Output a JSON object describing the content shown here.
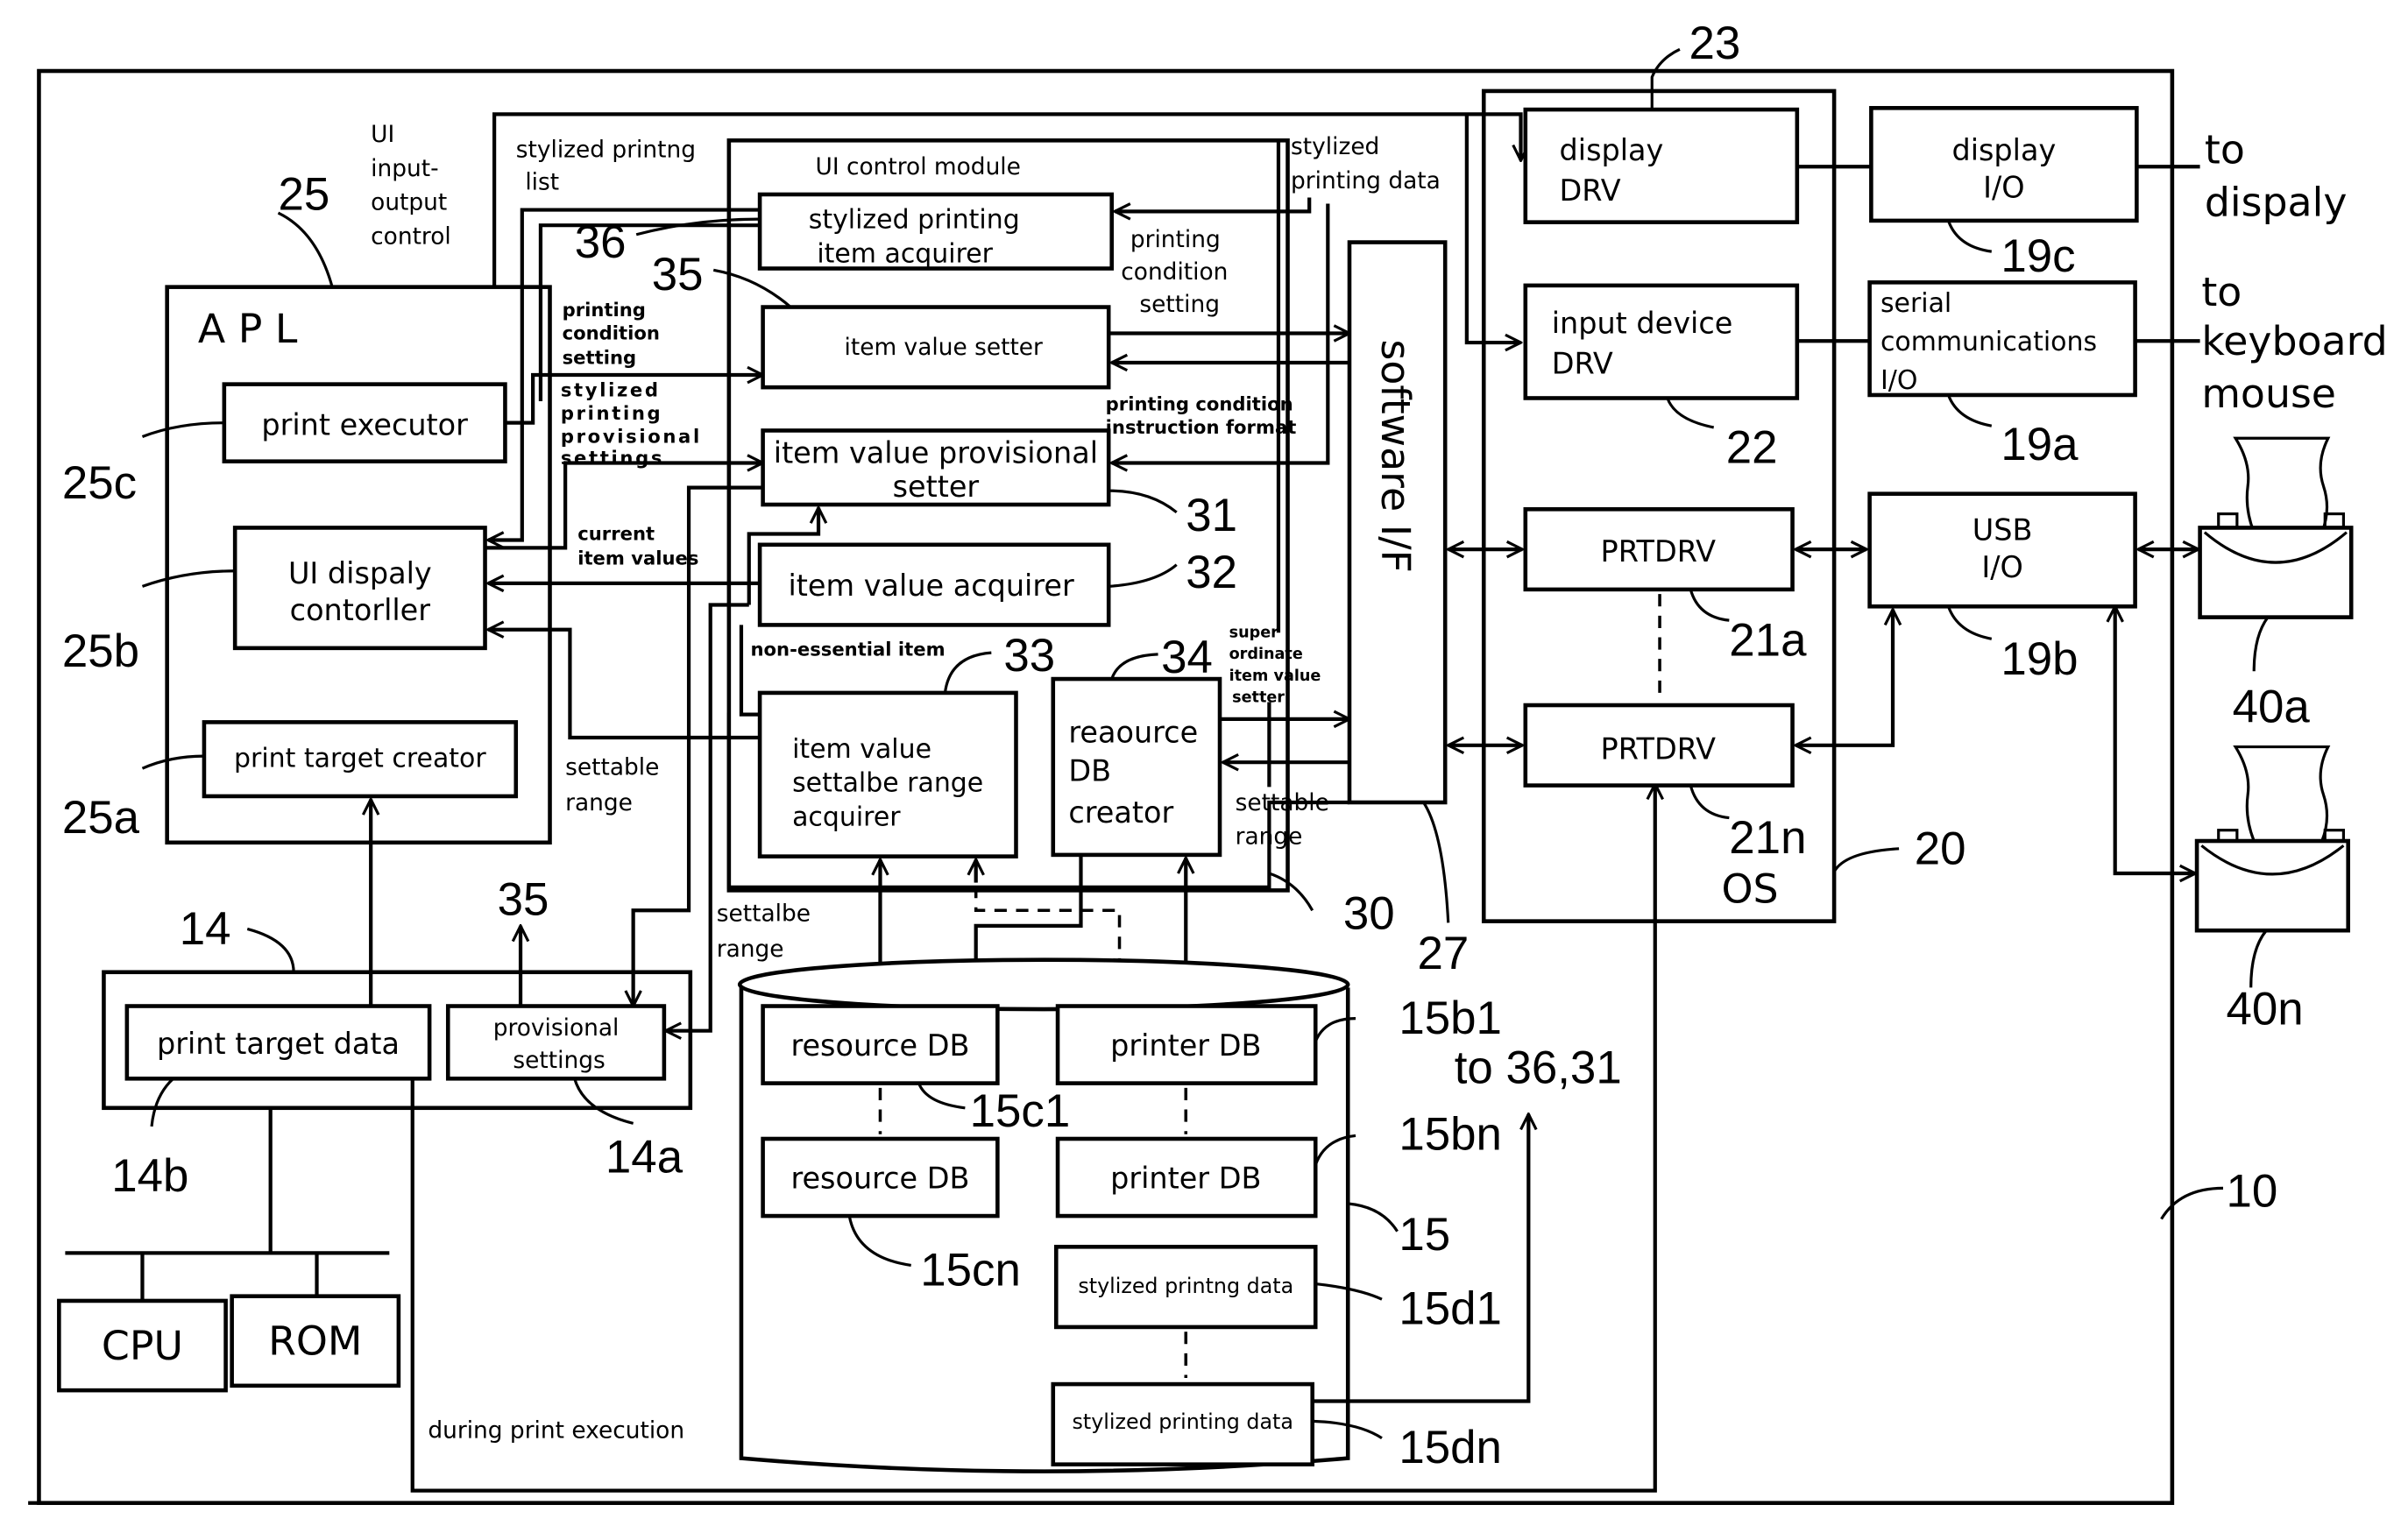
{
  "figure": {
    "outer_ref": "10",
    "apl": {
      "title": "A P L",
      "ref": "25",
      "control_label": [
        "UI",
        "input-",
        "output",
        "control"
      ],
      "print_executor": {
        "label": "print executor",
        "ref": "25c"
      },
      "ui_display_controller": {
        "line1": "UI dispaly",
        "line2": "contorller",
        "ref": "25b"
      },
      "print_target_creator": {
        "label": "print target creator",
        "ref": "25a"
      }
    },
    "memory": {
      "ref": "14",
      "print_target_data": {
        "label": "print target data",
        "ref": "14b"
      },
      "provisional_settings": {
        "line1": "provisional",
        "line2": "settings",
        "ref": "14a"
      },
      "to_ref": "35"
    },
    "hardware": {
      "cpu": "CPU",
      "rom": "ROM"
    },
    "ui_control_module": {
      "title": "UI control module",
      "ref": "30",
      "stylized_printing_item_acquirer": {
        "line1": "stylized printing",
        "line2": "item acquirer",
        "ref": "36"
      },
      "item_value_setter": {
        "label": "item value setter",
        "ref": "35"
      },
      "item_value_provisional_setter": {
        "line1": "item value provisional",
        "line2": "setter",
        "ref": "31"
      },
      "item_value_acquirer": {
        "label": "item value acquirer",
        "ref": "32"
      },
      "item_value_settable_range_acquirer": {
        "line1": "item value",
        "line2": "settalbe range",
        "line3": "acquirer",
        "ref": "33"
      },
      "resource_db_creator": {
        "line1": "reaource",
        "line2": "DB",
        "line3": "creator",
        "ref": "34"
      }
    },
    "flow_labels": {
      "stylized_printing_list": [
        "stylized printng",
        "list"
      ],
      "stylized_printing_data": [
        "stylized",
        "printing data"
      ],
      "printing_condition_setting_right": [
        "printing",
        "condition",
        "setting"
      ],
      "printing_condition_setting_left": [
        "printing",
        "condition",
        "setting"
      ],
      "stylized_printing_provisional_settings": [
        "stylized",
        "printing",
        "provisional",
        "settings"
      ],
      "current_item_values": [
        "current",
        "item values"
      ],
      "printing_condition_instruction_format": [
        "printing condition",
        "instruction format"
      ],
      "non_essential_item": "non-essential item",
      "super_ordinate_item_value_setter": [
        "super",
        "ordinate",
        "item value",
        "setter"
      ],
      "settable_range_left": [
        "settable",
        "range"
      ],
      "settable_range_right": [
        "settable",
        "range"
      ],
      "settable_range_bottom": [
        "settalbe",
        "range"
      ],
      "during_print_execution": "during print execution",
      "to_36_31": "to 36,31"
    },
    "software_if": {
      "label": "software I/F",
      "ref": "27"
    },
    "os": {
      "label": "OS",
      "ref": "20",
      "display_drv": {
        "line1": "display",
        "line2": "DRV",
        "ref": "23"
      },
      "input_device_drv": {
        "line1": "input device",
        "line2": "DRV",
        "ref": "22"
      },
      "prtdrv_a": {
        "label": "PRTDRV",
        "ref": "21a"
      },
      "prtdrv_n": {
        "label": "PRTDRV",
        "ref": "21n"
      }
    },
    "io": {
      "display_io": {
        "line1": "display",
        "line2": "I/O",
        "ref": "19c"
      },
      "serial_io": {
        "line1": "serial",
        "line2": "communications",
        "line3": "I/O",
        "ref": "19a"
      },
      "usb_io": {
        "line1": "USB",
        "line2": "I/O",
        "ref": "19b"
      }
    },
    "external": {
      "to_display": [
        "to",
        "dispaly"
      ],
      "to_keyboard_mouse": [
        "to",
        "keyboard",
        "mouse"
      ],
      "printer_a_ref": "40a",
      "printer_n_ref": "40n"
    },
    "storage": {
      "ref": "15",
      "resource_db_1": {
        "label": "resource DB",
        "ref": "15c1"
      },
      "resource_db_n": {
        "label": "resource DB",
        "ref": "15cn"
      },
      "printer_db_1": {
        "label": "printer DB",
        "ref": "15b1"
      },
      "printer_db_n": {
        "label": "printer DB",
        "ref": "15bn"
      },
      "stylized_data_1": {
        "label": "stylized printng data",
        "ref": "15d1"
      },
      "stylized_data_n": {
        "label": "stylized printing data",
        "ref": "15dn"
      }
    }
  }
}
